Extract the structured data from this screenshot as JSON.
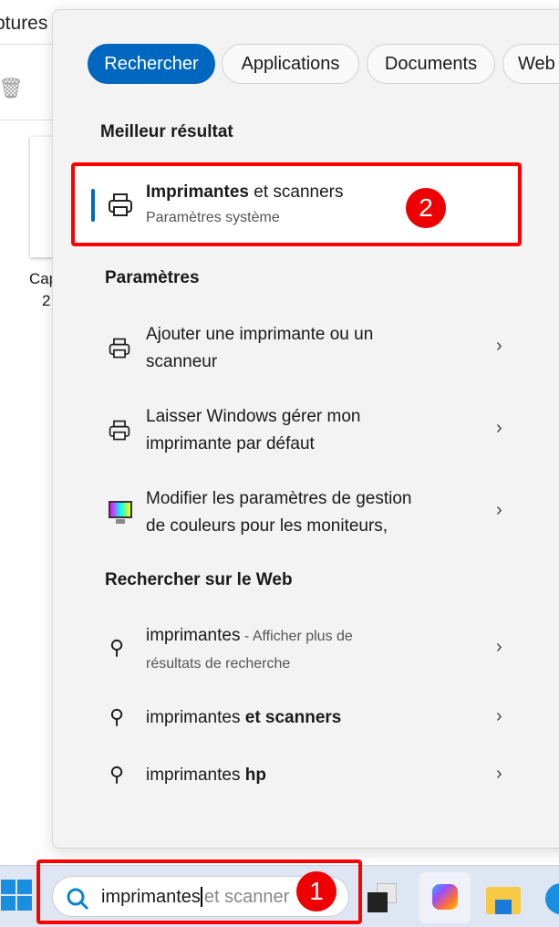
{
  "background": {
    "explorer_title": "ptures d",
    "caption_line1": "Cap",
    "caption_line2": "2"
  },
  "tabs": [
    {
      "label": "Rechercher",
      "active": true
    },
    {
      "label": "Applications"
    },
    {
      "label": "Documents"
    },
    {
      "label": "Web"
    }
  ],
  "best": {
    "header": "Meilleur résultat",
    "title_bold": "Imprimantes",
    "title_rest": " et scanners",
    "subtitle": "Paramètres système",
    "badge": "2"
  },
  "settings": {
    "header": "Paramètres",
    "items": [
      {
        "line1": "Ajouter une imprimante ou un",
        "line2": "scanneur",
        "icon": "printer-icon"
      },
      {
        "line1": "Laisser Windows gérer mon",
        "line2": "imprimante par défaut",
        "icon": "printer-icon"
      },
      {
        "line1": "Modifier les paramètres de gestion",
        "line2": "de couleurs pour les moniteurs,",
        "icon": "monitor-color-icon"
      }
    ]
  },
  "web": {
    "header": "Rechercher sur le Web",
    "items": [
      {
        "main": "imprimantes",
        "hint": " - Afficher plus de",
        "line2": "résultats de recherche"
      },
      {
        "main": "imprimantes ",
        "bold": "et scanners"
      },
      {
        "main": "imprimantes ",
        "bold": "hp"
      }
    ]
  },
  "taskbar": {
    "typed": "imprimantes",
    "suggestion": "et scanner",
    "badge": "1"
  },
  "colors": {
    "accent": "#0067c0",
    "highlight": "#ff0000"
  }
}
